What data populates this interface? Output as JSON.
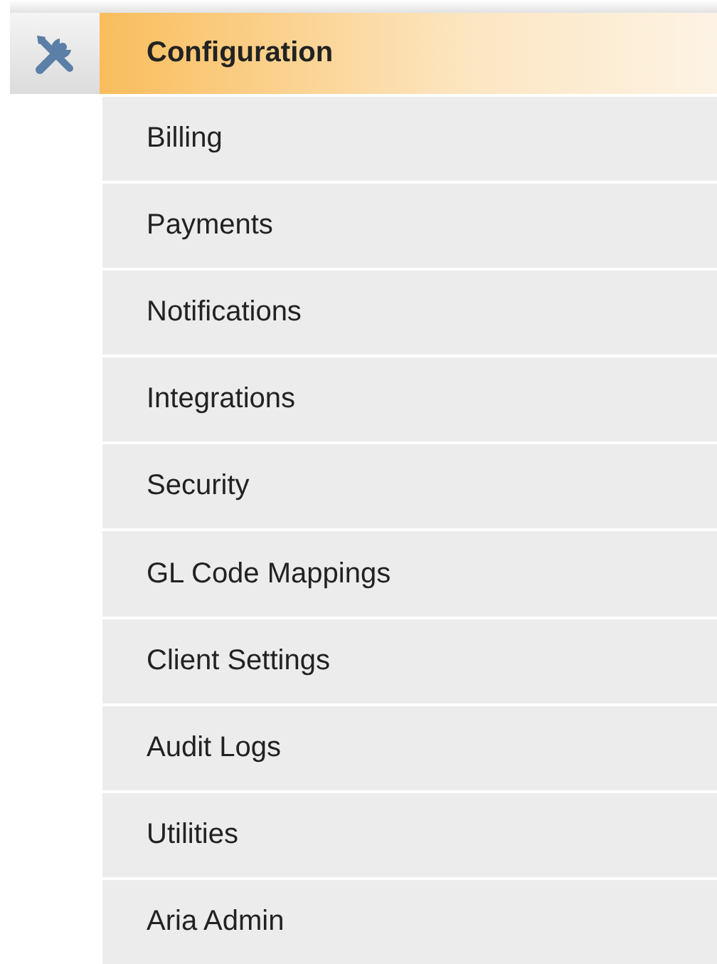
{
  "section": {
    "title": "Configuration"
  },
  "items": [
    {
      "label": "Billing"
    },
    {
      "label": "Payments"
    },
    {
      "label": "Notifications"
    },
    {
      "label": "Integrations"
    },
    {
      "label": "Security"
    },
    {
      "label": "GL Code Mappings"
    },
    {
      "label": "Client Settings"
    },
    {
      "label": "Audit Logs"
    },
    {
      "label": "Utilities"
    },
    {
      "label": "Aria Admin"
    }
  ]
}
